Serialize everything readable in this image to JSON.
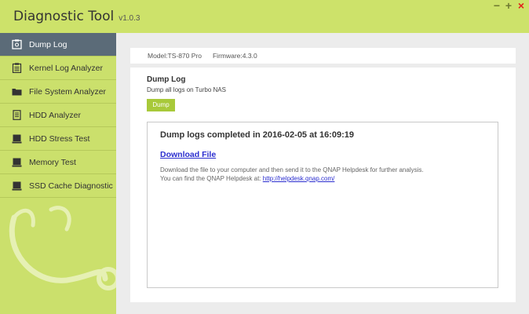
{
  "app": {
    "title": "Diagnostic Tool",
    "version": "v1.0.3"
  },
  "window_controls": {
    "minimize": "−",
    "maximize": "+",
    "close": "×"
  },
  "sidebar": {
    "items": [
      {
        "label": "Dump Log",
        "icon": "dump-log-icon",
        "active": true
      },
      {
        "label": "Kernel Log Analyzer",
        "icon": "clipboard-icon"
      },
      {
        "label": "File System Analyzer",
        "icon": "folder-icon"
      },
      {
        "label": "HDD Analyzer",
        "icon": "document-icon"
      },
      {
        "label": "HDD Stress Test",
        "icon": "hard-drive-icon"
      },
      {
        "label": "Memory Test",
        "icon": "memory-icon"
      },
      {
        "label": "SSD Cache Diagnostic",
        "icon": "ssd-icon"
      }
    ]
  },
  "info": {
    "model": "Model:TS-870 Pro",
    "firmware": "Firmware:4.3.0"
  },
  "panel": {
    "title": "Dump Log",
    "subtitle": "Dump all logs on Turbo NAS",
    "button_label": "Dump",
    "result_message": "Dump logs completed in 2016-02-05 at 16:09:19",
    "download_label": "Download File",
    "desc_line1": "Download the file to your computer and then send it to the QNAP Helpdesk for further analysis.",
    "desc_line2_prefix": "You can find the QNAP Helpdesk at: ",
    "helpdesk_link": "http://helpdesk.qnap.com/"
  },
  "colors": {
    "accent_green": "#cde26a",
    "sidebar_active": "#5b6b78",
    "button_green": "#a8c93a",
    "link_blue": "#2b2ecf",
    "close_red": "#e2201b"
  }
}
